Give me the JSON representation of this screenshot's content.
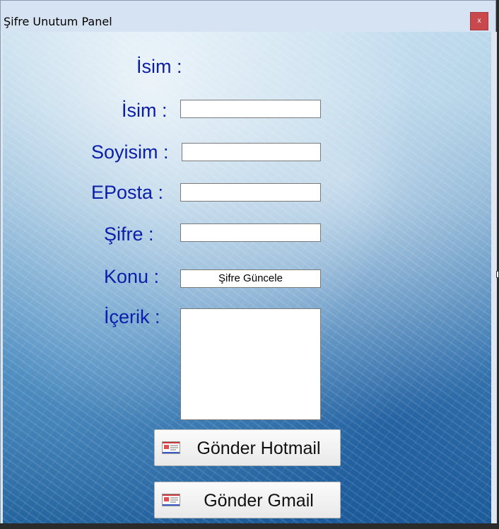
{
  "window": {
    "title": "Şifre Unutum Panel",
    "close_label": "x"
  },
  "form": {
    "header_label": "İsim :",
    "fields": {
      "isim": {
        "label": "İsim :",
        "value": ""
      },
      "soyisim": {
        "label": "Soyisim :",
        "value": ""
      },
      "eposta": {
        "label": "EPosta :",
        "value": ""
      },
      "sifre": {
        "label": "Şifre :",
        "value": ""
      },
      "konu": {
        "label": "Konu :",
        "value": "Şifre Güncele"
      },
      "icerik": {
        "label": "İçerik :",
        "value": ""
      }
    }
  },
  "buttons": {
    "hotmail_label": "Gönder Hotmail",
    "gmail_label": "Gönder Gmail",
    "icon": "envelope-icon"
  },
  "colors": {
    "label_text": "#0a1ea8",
    "close_button": "#c9484b",
    "title_bar": "#d6e3f2"
  }
}
